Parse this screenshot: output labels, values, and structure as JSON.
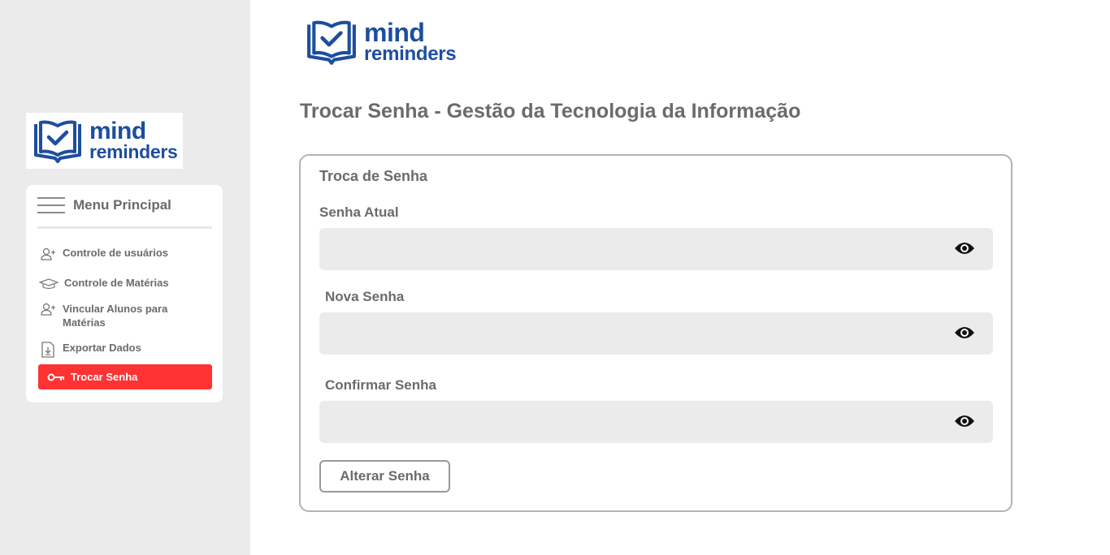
{
  "brand": {
    "line1": "mind",
    "line2": "reminders",
    "color": "#1d4e9e"
  },
  "sidebar": {
    "menu_title": "Menu Principal",
    "items": [
      {
        "label": "Controle de usuários",
        "icon": "user-add-icon"
      },
      {
        "label": "Controle de Matérias",
        "icon": "graduation-cap-icon"
      },
      {
        "label": "Vincular Alunos para Matérias",
        "icon": "user-add-icon"
      },
      {
        "label": "Exportar Dados",
        "icon": "file-download-icon"
      },
      {
        "label": "Trocar Senha",
        "icon": "key-icon",
        "active": true
      }
    ],
    "active_color": "#ff3333"
  },
  "main": {
    "title": "Trocar Senha - Gestão da Tecnologia da Informação",
    "card_title": "Troca de Senha",
    "fields": [
      {
        "label": "Senha Atual",
        "value": "",
        "icon": "eye-icon"
      },
      {
        "label": "Nova Senha",
        "value": "",
        "icon": "eye-icon"
      },
      {
        "label": "Confirmar Senha",
        "value": "",
        "icon": "eye-icon"
      }
    ],
    "submit_label": "Alterar Senha"
  }
}
